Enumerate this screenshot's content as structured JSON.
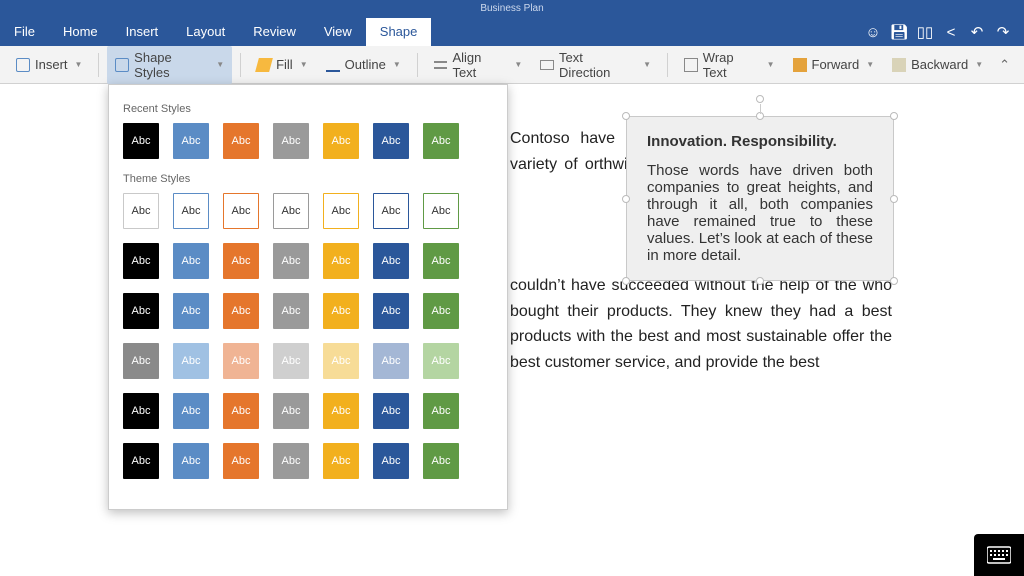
{
  "title": "Business Plan",
  "menus": {
    "file": "File",
    "home": "Home",
    "insert": "Insert",
    "layout": "Layout",
    "review": "Review",
    "view": "View",
    "shape": "Shape"
  },
  "ribbon": {
    "insert": "Insert",
    "shape_styles": "Shape Styles",
    "fill": "Fill",
    "outline": "Outline",
    "align_text": "Align Text",
    "text_direction": "Text Direction",
    "wrap_text": "Wrap Text",
    "forward": "Forward",
    "backward": "Backward"
  },
  "styles_panel": {
    "recent_label": "Recent Styles",
    "theme_label": "Theme Styles",
    "swatch_text": "Abc",
    "palette": [
      "#000000",
      "#5b8cc5",
      "#e5762c",
      "#9a9a9a",
      "#f2b01e",
      "#2b579a",
      "#609a45"
    ],
    "outline_palette": [
      "#c9c9c9",
      "#5b8cc5",
      "#e5762c",
      "#9a9a9a",
      "#f2b01e",
      "#2b579a",
      "#609a45"
    ],
    "light_palette": [
      "#8a8a8a",
      "#a0c1e3",
      "#f0b494",
      "#cfcfcf",
      "#f7dc97",
      "#a4b7d5",
      "#b4d5a2"
    ]
  },
  "doc": {
    "p1": "Contoso have ple. Thanks to esearch and ed a variety of orthwind and ughs in smart systems, and",
    "p2": "couldn’t have succeeded without the help of the who bought their products. They knew they had a best products with the best and most sustainable offer the best customer service, and provide the best",
    "shape_heading": "Innovation. Responsibility.",
    "shape_body": "Those words have driven both companies to great heights, and through it all, both companies have remained true to these values. Let’s look at each of these in more detail."
  }
}
